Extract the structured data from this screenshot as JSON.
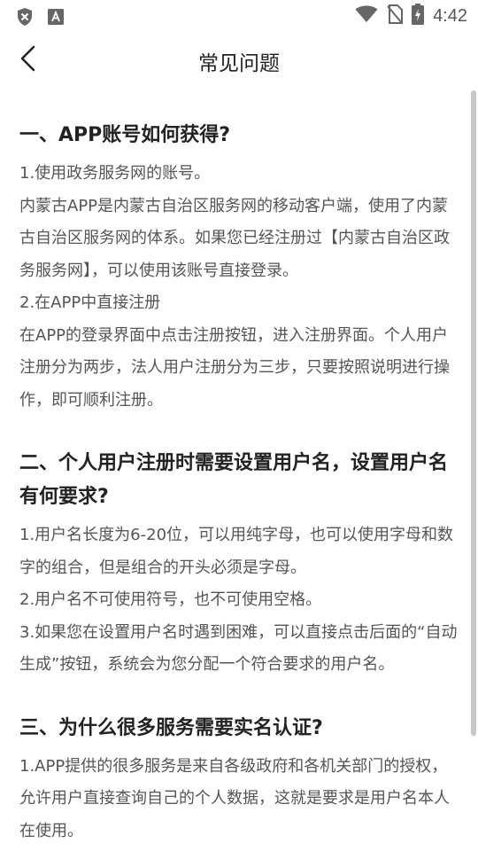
{
  "status_bar": {
    "time": "4:42",
    "icons": [
      "shield-icon",
      "font-a-icon",
      "wifi-icon",
      "no-sim-icon",
      "battery-charging-icon"
    ]
  },
  "app_bar": {
    "title": "常见问题",
    "back_icon": "chevron-left-icon"
  },
  "faq": [
    {
      "question": "一、APP账号如何获得?",
      "paragraphs": [
        "1.使用政务服务网的账号。",
        "内蒙古APP是内蒙古自治区服务网的移动客户端，使用了内蒙古自治区服务网的体系。如果您已经注册过【内蒙古自治区政务服务网】，可以使用该账号直接登录。",
        "2.在APP中直接注册",
        "在APP的登录界面中点击注册按钮，进入注册界面。个人用户注册分为两步，法人用户注册分为三步，只要按照说明进行操作，即可顺利注册。"
      ]
    },
    {
      "question": "二、个人用户注册时需要设置用户名，设置用户名有何要求?",
      "paragraphs": [
        "1.用户名长度为6-20位，可以用纯字母，也可以使用字母和数字的组合，但是组合的开头必须是字母。",
        "2.用户名不可使用符号，也不可使用空格。",
        "3.如果您在设置用户名时遇到困难，可以直接点击后面的“自动生成”按钮，系统会为您分配一个符合要求的用户名。"
      ]
    },
    {
      "question": "三、为什么很多服务需要实名认证?",
      "paragraphs": [
        "1.APP提供的很多服务是来自各级政府和各机关部门的授权，允许用户直接查询自己的个人数据，这就是要求是用户名本人在使用。"
      ]
    }
  ]
}
